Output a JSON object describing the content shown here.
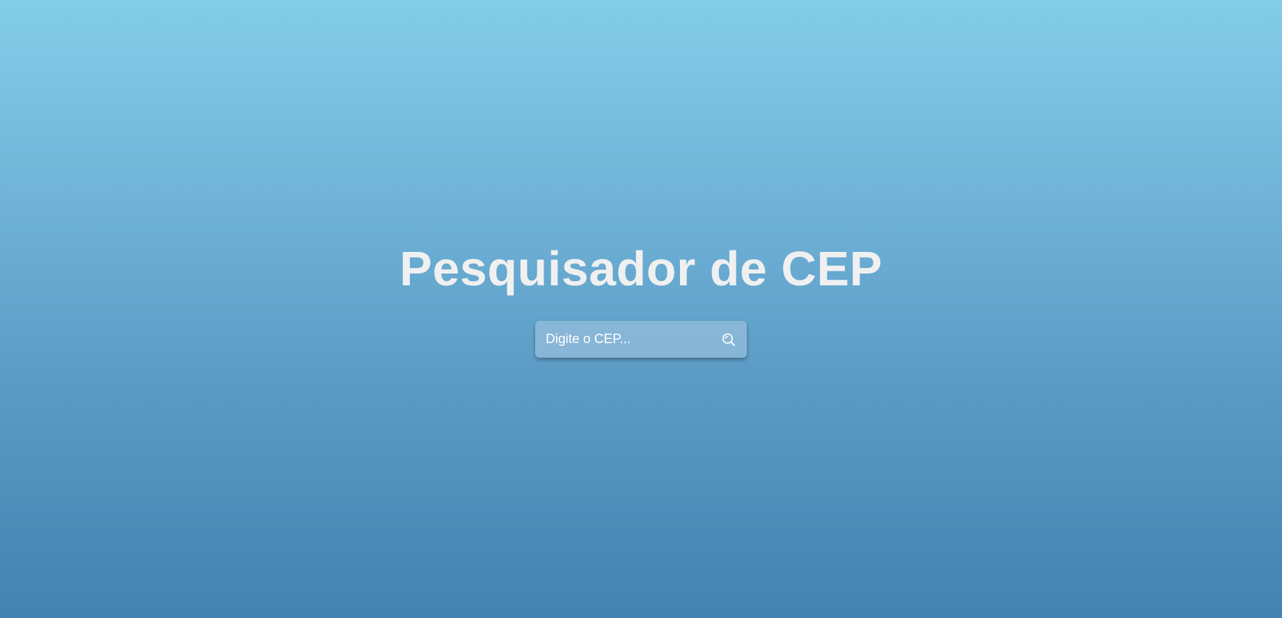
{
  "page": {
    "title": "Pesquisador de CEP"
  },
  "search": {
    "placeholder": "Digite o CEP...",
    "value": "",
    "button_icon": "search-icon"
  },
  "colors": {
    "background_top": "#83cde8",
    "background_bottom": "#4482b0",
    "title_text": "#f0f0f0",
    "input_text": "#ffffff"
  }
}
